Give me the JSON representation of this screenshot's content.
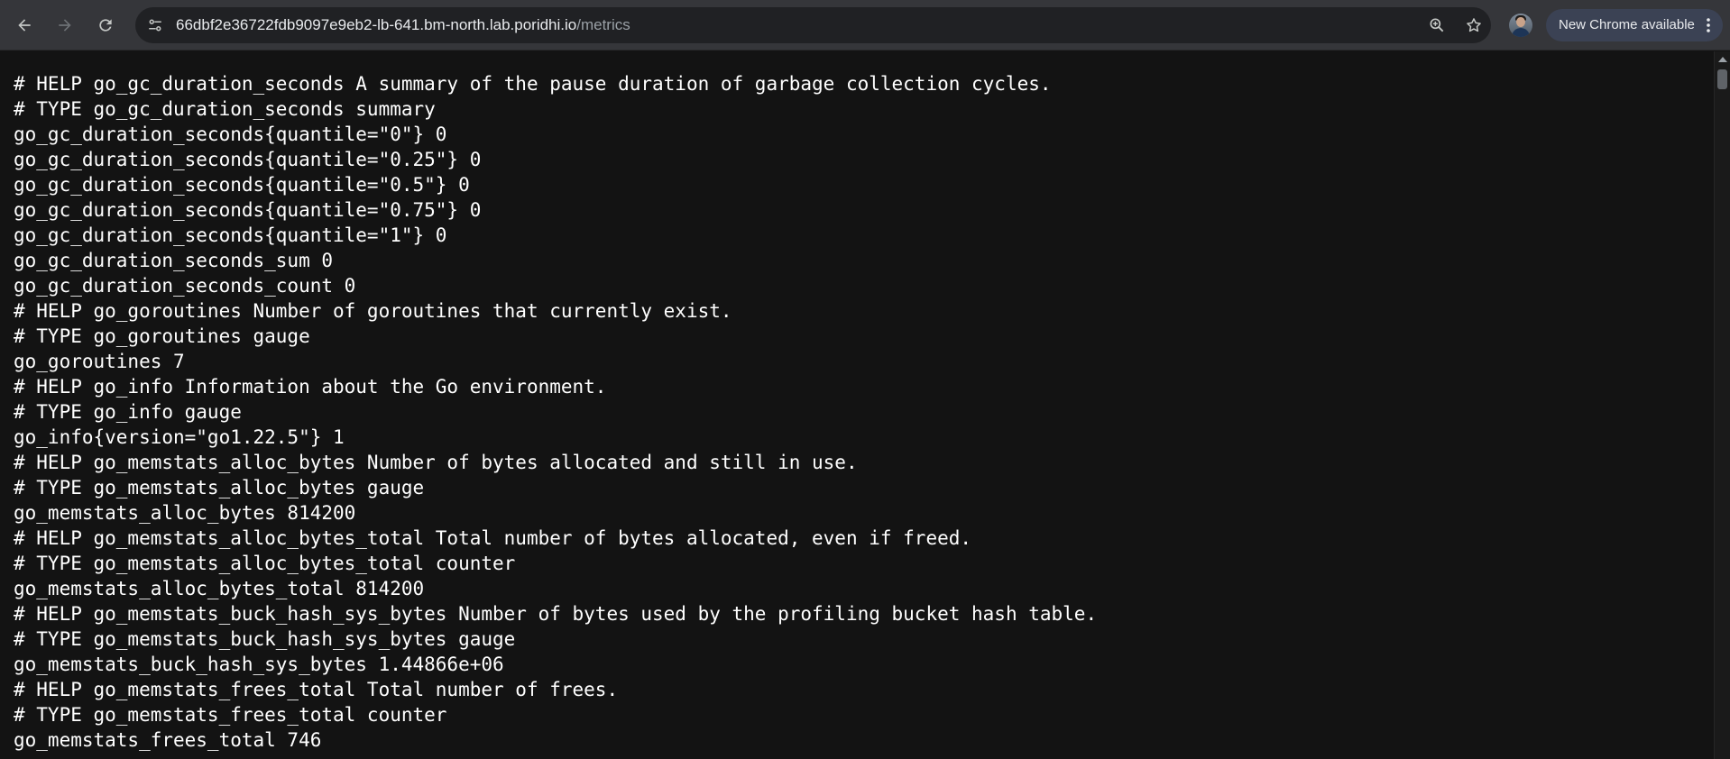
{
  "browser": {
    "url_host": "66dbf2e36722fdb9097e9eb2-lb-641.bm-north.lab.poridhi.io",
    "url_path": "/metrics",
    "update_chip_label": "New Chrome available",
    "icons": {
      "back": "arrow-left-icon",
      "forward": "arrow-right-icon",
      "reload": "reload-icon",
      "site_info": "tune-icon",
      "zoom": "zoom-in-icon",
      "bookmark": "star-icon",
      "profile": "avatar",
      "menu": "kebab-menu-icon"
    }
  },
  "metrics": {
    "lines": [
      "# HELP go_gc_duration_seconds A summary of the pause duration of garbage collection cycles.",
      "# TYPE go_gc_duration_seconds summary",
      "go_gc_duration_seconds{quantile=\"0\"} 0",
      "go_gc_duration_seconds{quantile=\"0.25\"} 0",
      "go_gc_duration_seconds{quantile=\"0.5\"} 0",
      "go_gc_duration_seconds{quantile=\"0.75\"} 0",
      "go_gc_duration_seconds{quantile=\"1\"} 0",
      "go_gc_duration_seconds_sum 0",
      "go_gc_duration_seconds_count 0",
      "# HELP go_goroutines Number of goroutines that currently exist.",
      "# TYPE go_goroutines gauge",
      "go_goroutines 7",
      "# HELP go_info Information about the Go environment.",
      "# TYPE go_info gauge",
      "go_info{version=\"go1.22.5\"} 1",
      "# HELP go_memstats_alloc_bytes Number of bytes allocated and still in use.",
      "# TYPE go_memstats_alloc_bytes gauge",
      "go_memstats_alloc_bytes 814200",
      "# HELP go_memstats_alloc_bytes_total Total number of bytes allocated, even if freed.",
      "# TYPE go_memstats_alloc_bytes_total counter",
      "go_memstats_alloc_bytes_total 814200",
      "# HELP go_memstats_buck_hash_sys_bytes Number of bytes used by the profiling bucket hash table.",
      "# TYPE go_memstats_buck_hash_sys_bytes gauge",
      "go_memstats_buck_hash_sys_bytes 1.44866e+06",
      "# HELP go_memstats_frees_total Total number of frees.",
      "# TYPE go_memstats_frees_total counter",
      "go_memstats_frees_total 746"
    ]
  }
}
